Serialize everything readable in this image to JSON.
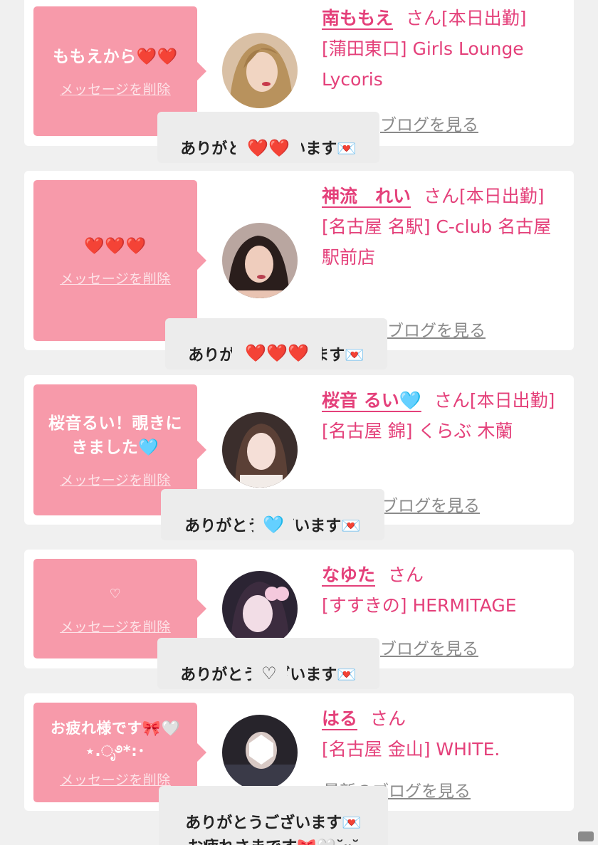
{
  "delete_label": "メッセージを削除",
  "blog_label": "ブログを見る",
  "blog_label_last": "最新のブログを見る",
  "san_suffix": "さん",
  "cards": [
    {
      "message": "ももえから",
      "message_hearts": "❤️❤️",
      "name": "南ももえ",
      "status": "[本日出勤]",
      "shop": "[蒲田東口] Girls Lounge Lycoris",
      "reply": "ありがとうございます💌",
      "reply_hearts": "❤️❤️"
    },
    {
      "message": "",
      "message_hearts": "❤️❤️❤️",
      "name": "神流　れい",
      "status": "[本日出勤]",
      "shop": "[名古屋 名駅] C-club 名古屋駅前店",
      "reply": "ありがとうございます💌",
      "reply_hearts": "❤️❤️❤️"
    },
    {
      "message": "桜音るい！覗きにきました🩵",
      "message_hearts": "",
      "name": "桜音 るい🩵",
      "status": "[本日出勤]",
      "shop": "[名古屋 錦] くらぶ 木蘭",
      "reply": "ありがとうございます💌",
      "reply_hearts": "🩵"
    },
    {
      "message": "♡",
      "message_hearts": "",
      "name": "なゆた",
      "status": "",
      "shop": "[すすきの] HERMITAGE",
      "reply": "ありがとうございます💌",
      "reply_hearts": "♡"
    },
    {
      "message": "お疲れ様です🎀🤍⋆.ೃ࿔*:･",
      "message_hearts": "",
      "name": "はる",
      "status": "",
      "shop": "[名古屋 金山] WHITE.",
      "reply": "ありがとうございます💌\nお疲れさまです🎀🤍˘ᵕ˘",
      "reply_hearts": ""
    }
  ]
}
